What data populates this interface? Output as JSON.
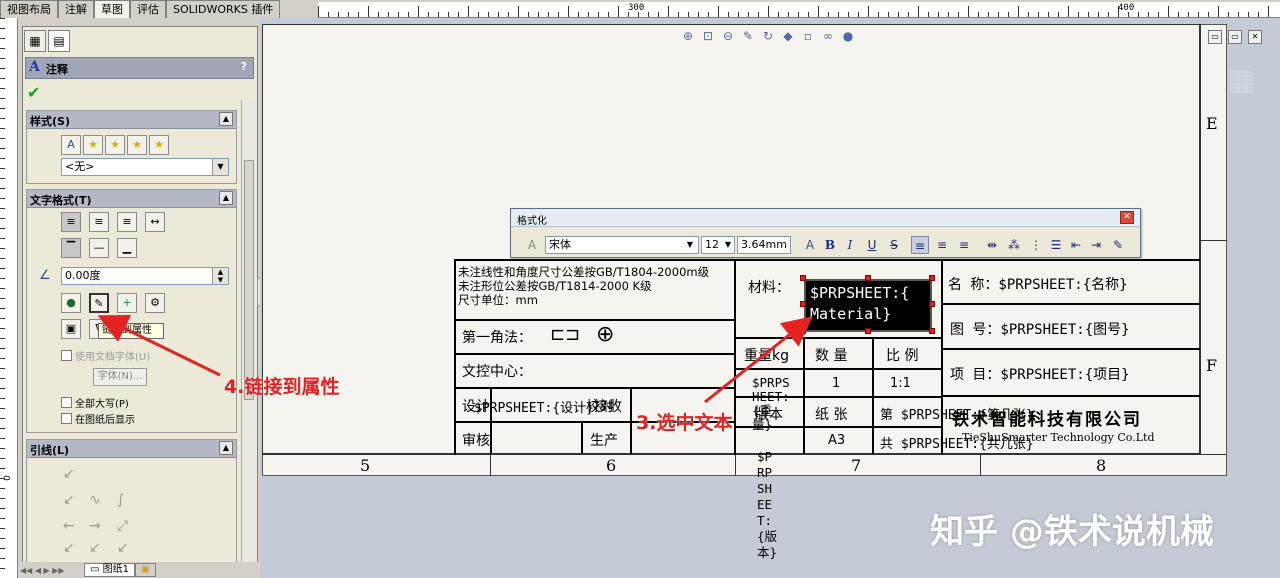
{
  "top_tabs": [
    "视图布局",
    "注解",
    "草图",
    "评估",
    "SOLIDWORKS 插件"
  ],
  "active_tab_index": 2,
  "ruler": {
    "labels": [
      "300",
      "400"
    ]
  },
  "vruler": {
    "label": "0"
  },
  "property_manager": {
    "title": "注释",
    "title_icon": "A",
    "help": "?",
    "ok": "✔",
    "style_group": {
      "title": "样式(S)",
      "dropdown_value": "<无>"
    },
    "text_format_group": {
      "title": "文字格式(T)",
      "angle_value": "0.00度",
      "use_doc_font": "使用文档字体(U)",
      "font_button": "字体(N)...",
      "all_caps": "全部大写(P)",
      "show_on_sheet": "在图纸后显示"
    },
    "leader_group": {
      "title": "引线(L)"
    },
    "tooltip": "链接到属性"
  },
  "sheet_tabs": {
    "sheet1": "图纸1"
  },
  "formatting_dialog": {
    "title": "格式化",
    "font": "宋体",
    "font_size": "12",
    "height": "3.64mm",
    "buttons": {
      "bold": "B",
      "italic": "I",
      "underline": "U",
      "strike": "S"
    }
  },
  "drawing": {
    "zones_col": [
      "5",
      "6",
      "7",
      "8"
    ],
    "zones_row": [
      "E",
      "F"
    ],
    "notes": {
      "line1": "未注线性和角度尺寸公差按GB/T1804-2000m级",
      "line2": "未注形位公差按GB/T1814-2000 K级",
      "line3": "尺寸单位：mm"
    },
    "first_angle": "第一角法：",
    "doc_center": "文控中心：",
    "design_label": "设计",
    "design_value": "$PRPSHEET:{设计}",
    "proofread": "校对",
    "accept": "接收",
    "review": "审核",
    "production": "生产",
    "material_label": "材料：",
    "material_value_l1": "$PRPSHEET:{",
    "material_value_l2": "Material}",
    "weight_label": "重量kg",
    "qty_label": "数 量",
    "scale_label": "比 例",
    "weight_value": "$PRPSHEET:{重量}",
    "qty_value": "1",
    "scale_value": "1:1",
    "version_label": "版本",
    "version_value": "$PRPSHEET:{版本}",
    "paper_label": "纸 张",
    "paper_value": "A3",
    "sheet_no": "第 $PRPSHEET:{第几张}",
    "sheet_total": "共 $PRPSHEET:{共几张}",
    "name_label": "名 称：$PRPSHEET:{名称}",
    "drawing_no": "图 号：$PRPSHEET:{图号}",
    "project": "项 目：$PRPSHEET:{项目}",
    "company_cn": "铁术智能科技有限公司",
    "company_en": "TieShuSmarter Technology Co.Ltd"
  },
  "annotations": {
    "step3": "3.选中文本",
    "step4": "4.链接到属性"
  },
  "watermark": "知乎 @铁术说机械",
  "colors": {
    "annotation_red": "#e42222",
    "selected_bg": "#000000",
    "handle_red": "#e02020"
  }
}
